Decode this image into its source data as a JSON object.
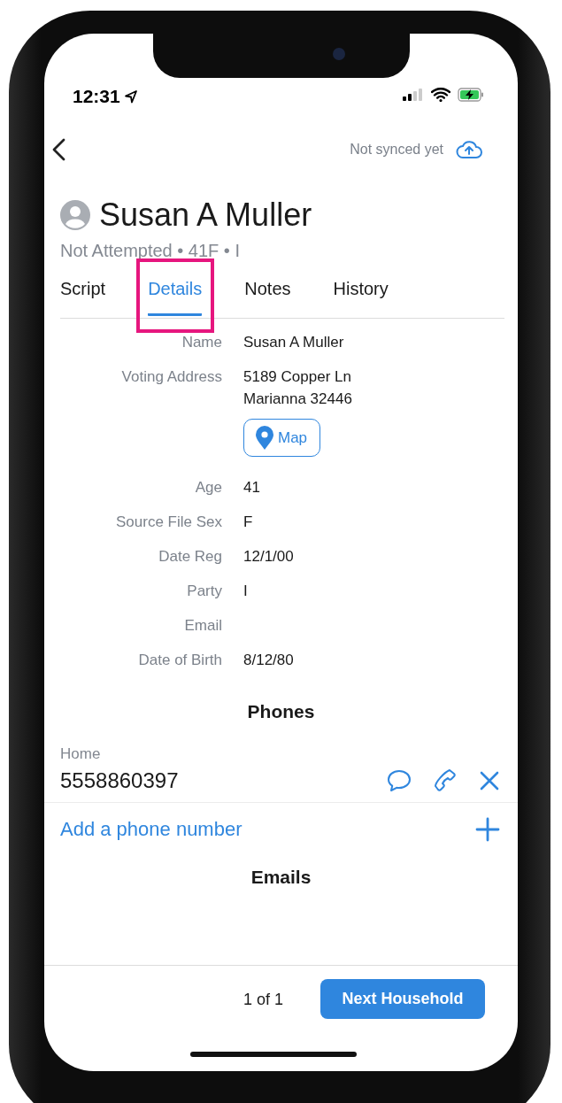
{
  "status_bar": {
    "time": "12:31"
  },
  "nav": {
    "sync_status": "Not synced yet"
  },
  "person": {
    "name": "Susan A Muller",
    "subtitle": "Not Attempted • 41F • I"
  },
  "tabs": [
    {
      "label": "Script",
      "selected": false,
      "highlighted": false
    },
    {
      "label": "Details",
      "selected": true,
      "highlighted": true
    },
    {
      "label": "Notes",
      "selected": false,
      "highlighted": false
    },
    {
      "label": "History",
      "selected": false,
      "highlighted": false
    }
  ],
  "details": [
    {
      "label": "Name",
      "lines": [
        "Susan A Muller"
      ]
    },
    {
      "label": "Voting Address",
      "lines": [
        "5189 Copper Ln",
        "Marianna 32446"
      ],
      "map_button": "Map"
    },
    {
      "label": "Age",
      "lines": [
        "41"
      ]
    },
    {
      "label": "Source File Sex",
      "lines": [
        "F"
      ]
    },
    {
      "label": "Date Reg",
      "lines": [
        "12/1/00"
      ]
    },
    {
      "label": "Party",
      "lines": [
        "I"
      ]
    },
    {
      "label": "Email"
    },
    {
      "label": "Date of Birth",
      "lines": [
        "8/12/80"
      ]
    }
  ],
  "phones": {
    "heading": "Phones",
    "items": [
      {
        "type": "Home",
        "number": "5558860397"
      }
    ],
    "add_label": "Add a phone number"
  },
  "emails": {
    "heading": "Emails"
  },
  "footer": {
    "counter": "1 of 1",
    "next_button": "Next Household"
  }
}
